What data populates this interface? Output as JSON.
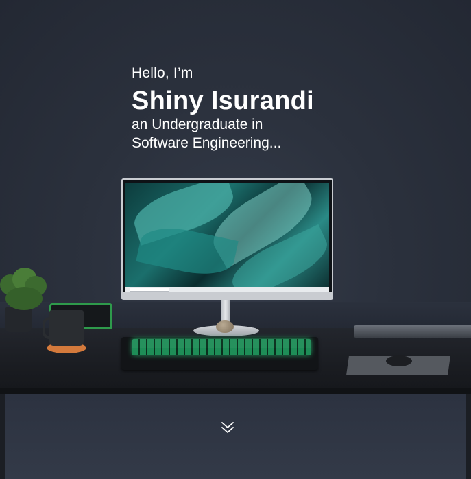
{
  "hero": {
    "greeting": "Hello, I’m",
    "name": "Shiny Isurandi",
    "tagline_line1": "an Undergraduate in",
    "tagline_line2": "Software Engineering..."
  },
  "scroll_indicator": {
    "icon": "double-chevron-down-icon"
  },
  "colors": {
    "text": "#ffffff",
    "background": "#2a303c",
    "keyboard_glow": "#2ecb7d"
  }
}
